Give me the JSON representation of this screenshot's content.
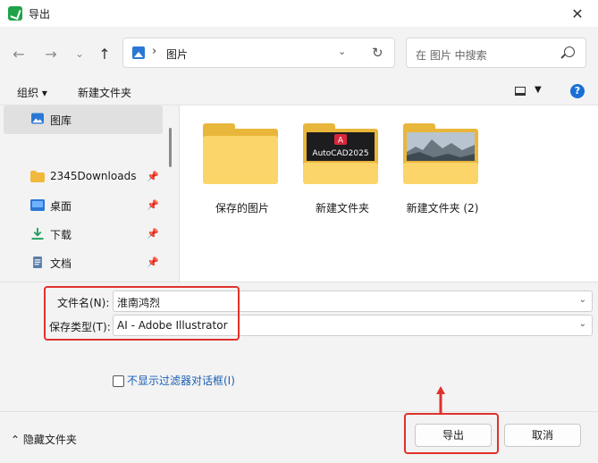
{
  "window": {
    "title": "导出"
  },
  "nav": {
    "back": "←",
    "forward": "→",
    "recent": "⌄",
    "up": "↑"
  },
  "address": {
    "separator": "›",
    "path": "图片",
    "refresh": "↻"
  },
  "search": {
    "placeholder": "在 图片 中搜索"
  },
  "toolbar": {
    "organize": "组织 ▾",
    "new_folder": "新建文件夹"
  },
  "sidebar": {
    "items": [
      {
        "label": "图库",
        "icon": "gallery-icon",
        "selected": true
      },
      {
        "label": "2345Downloads",
        "icon": "folder-icon",
        "pinned": true
      },
      {
        "label": "桌面",
        "icon": "desktop-icon",
        "pinned": true
      },
      {
        "label": "下载",
        "icon": "download-icon",
        "pinned": true
      },
      {
        "label": "文档",
        "icon": "document-icon",
        "pinned": true
      }
    ]
  },
  "files": [
    {
      "label": "保存的图片",
      "thumb": "none"
    },
    {
      "label": "新建文件夹",
      "thumb": "AutoCAD2025"
    },
    {
      "label": "新建文件夹 (2)",
      "thumb": "landscape"
    }
  ],
  "form": {
    "filename_label": "文件名(N):",
    "filename_value": "淮南鸿烈",
    "type_label": "保存类型(T):",
    "type_value": "AI - Adobe Illustrator",
    "checkbox_label": "不显示过滤器对话框(I)"
  },
  "footer": {
    "hide_folders": "隐藏文件夹",
    "export_btn": "导出",
    "cancel_btn": "取消"
  },
  "colors": {
    "accent": "#1a6fd4",
    "highlight": "#e0322c",
    "folder": "#fbd56a"
  }
}
